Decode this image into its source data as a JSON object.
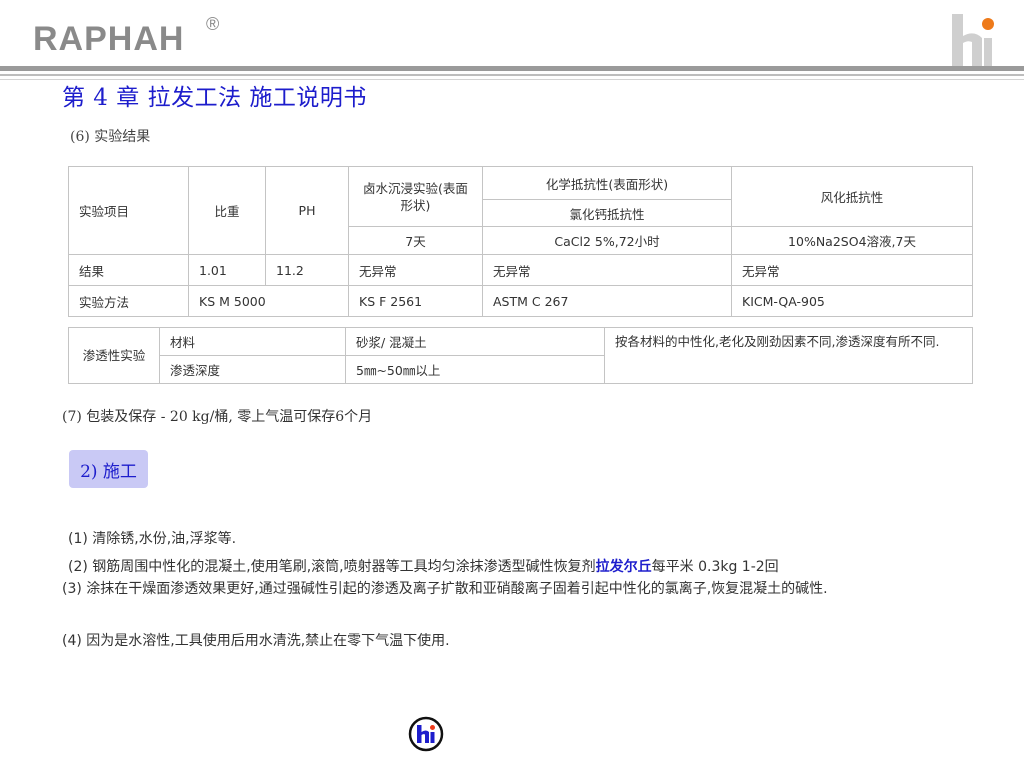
{
  "header": {
    "brand": "RAPHAH",
    "registered": "®",
    "title": "第 4 章  拉发工法 施工说明书"
  },
  "section6": {
    "heading": "(6) 实验结果"
  },
  "table1": {
    "col_item": "实验项目",
    "col_density": "比重",
    "col_ph": "PH",
    "col_brine": "卤水沉浸实验(表面形状)",
    "col_chem": "化学抵抗性(表面形状)",
    "col_chem_sub": "氯化钙抵抗性",
    "col_weather": "风化抵抗性",
    "cond_brine": "7天",
    "cond_chem": "CaCl2 5%,72小时",
    "cond_weather": "10%Na2SO4溶液,7天",
    "rows": [
      [
        "结果",
        "1.01",
        "11.2",
        "无异常",
        "无异常",
        "无异常"
      ],
      [
        "实验方法",
        "KS M 5000",
        "",
        "KS F 2561",
        "ASTM C 267",
        "KICM-QA-905"
      ]
    ]
  },
  "table2": {
    "label": "渗透性实验",
    "row1_name": "材料",
    "row1_value": "砂浆/ 混凝土",
    "row2_name": "渗透深度",
    "row2_value": "5㎜~50㎜以上",
    "note": "按各材料的中性化,老化及刚劲因素不同,渗透深度有所不同."
  },
  "section7": {
    "text": "(7) 包装及保存 - 20 kg/桶, 零上气温可保存6个月"
  },
  "section_construction": {
    "badge": "2) 施工",
    "step1": "(1) 清除锈,水份,油,浮浆等.",
    "step2_before": "(2) 钢筋周围中性化的混凝土,使用笔刷,滚筒,喷射器等工具均匀涂抹渗透型碱性恢复剂",
    "step2_product": "拉发尔丘",
    "step2_after": "每平米 0.3kg 1-2回",
    "step3": "(3) 涂抹在干燥面渗透效果更好,通过强碱性引起的渗透及离子扩散和亚硝酸离子固着引起中性化的氯离子,恢复混凝土的碱性.",
    "step4": "(4) 因为是水溶性,工具使用后用水清洗,禁止在零下气温下使用."
  },
  "colors": {
    "title_blue": "#1d1dcc",
    "badge_bg": "#c9c9f5",
    "logo_orange": "#ee7a1a",
    "brand_grey": "#8a8a8a"
  },
  "icons": {
    "corner": "hi-logo-icon",
    "bottom": "hi-circle-logo-icon"
  }
}
